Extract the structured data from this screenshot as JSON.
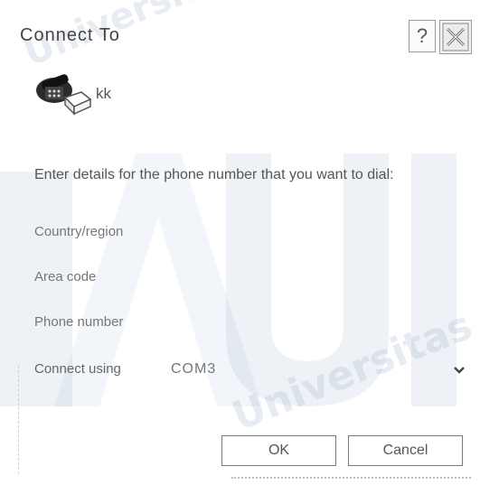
{
  "window": {
    "title": "Connect To",
    "help_label": "?",
    "close_icon": "close-icon",
    "help_icon": "question-icon"
  },
  "connection": {
    "icon": "phone-icon",
    "name": "kk"
  },
  "form": {
    "instruction": "Enter details for the phone number that you want to dial:",
    "country_label": "Country/region",
    "area_label": "Area code",
    "phone_label": "Phone number",
    "connect_label": "Connect using",
    "connect_value": "COM3"
  },
  "buttons": {
    "ok": "OK",
    "cancel": "Cancel"
  },
  "watermark": {
    "text_1": "Universitas Al Azhar Indonesia",
    "text_2": "Universitas Al Azhar",
    "logo": "UAI"
  },
  "colors": {
    "text": "#555555",
    "border": "#777777",
    "watermark": "#7896b9"
  }
}
